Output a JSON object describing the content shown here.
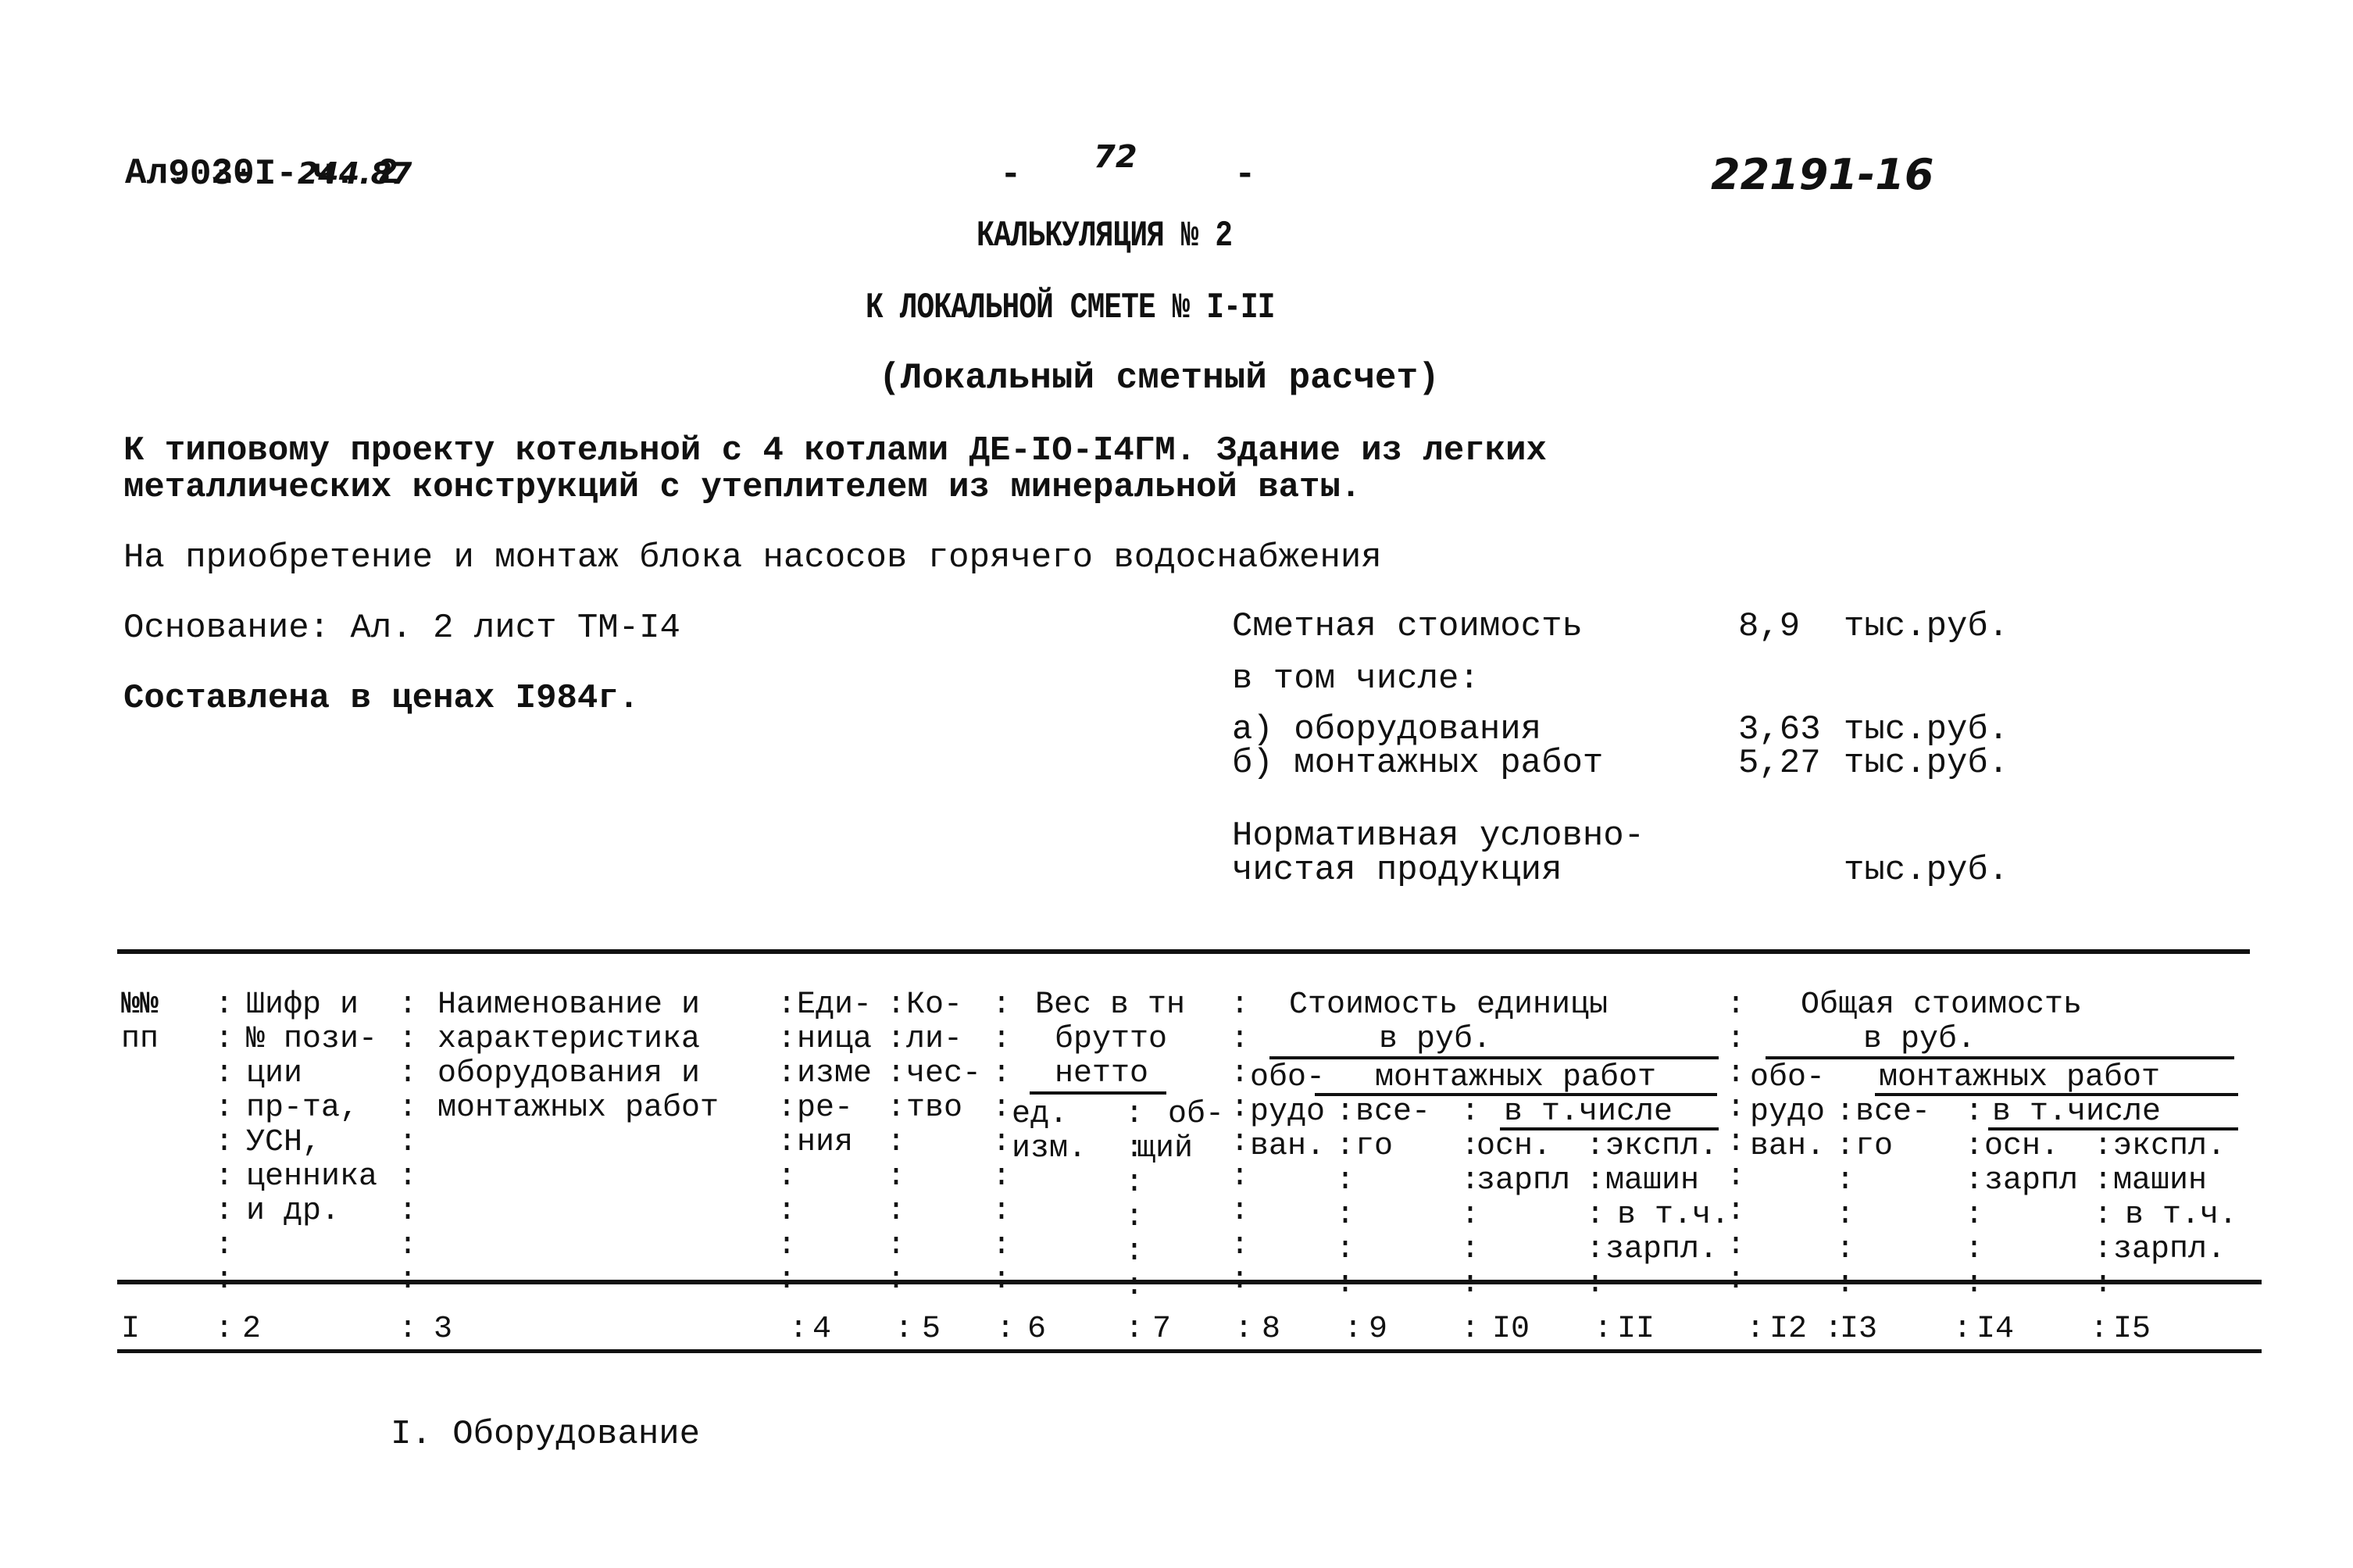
{
  "header": {
    "code": "903-I-",
    "code_handwritten": "244.87",
    "album": "Ал. 20",
    "part": "ч. 2",
    "page_number": "72",
    "page_dash_left": "-",
    "page_dash_right": "-",
    "doc_number": "22191-16"
  },
  "title": {
    "line1": "КАЛЬКУЛЯЦИЯ № 2",
    "line2": "К ЛОКАЛЬНОЙ СМЕТЕ № I-II",
    "line3": "(Локальный сметный расчет)"
  },
  "description": {
    "project_line1": "К типовому проекту котельной с 4 котлами ДЕ-IO-I4ГМ. Здание из легких",
    "project_line2": "металлических конструкций с утеплителем из минеральной ваты.",
    "purpose": "На приобретение и монтаж блока насосов горячего водоснабжения",
    "basis": "Основание: Ал. 2 лист ТМ-I4",
    "prices": "Составлена в ценах I984г."
  },
  "cost_summary": {
    "estimated_cost_label": "Сметная стоимость",
    "estimated_cost_value": "8,9",
    "unit": "тыс.руб.",
    "including_label": "в том числе:",
    "items": [
      {
        "label": "а) оборудования",
        "value": "3,63",
        "unit": "тыс.руб."
      },
      {
        "label": "б) монтажных работ",
        "value": "5,27",
        "unit": "тыс.руб."
      }
    ],
    "normative_label_line1": "Нормативная условно-",
    "normative_label_line2": "чистая продукция",
    "normative_value": "",
    "normative_unit": "тыс.руб."
  },
  "table": {
    "col1": [
      "№№",
      "пп"
    ],
    "col2": [
      "Шифр и",
      "№ пози-",
      "ции",
      "пр-та,",
      "УСН,",
      "ценника",
      "и др."
    ],
    "col3": [
      "Наименование и",
      "характеристика",
      "оборудования и",
      "монтажных работ"
    ],
    "col4": [
      "Еди-",
      "ница",
      "изме",
      "ре-",
      "ния"
    ],
    "col5": [
      "Ко-",
      "ли-",
      "чес-",
      "тво"
    ],
    "weight_group": [
      "Вес в тн",
      "брутто",
      "нетто"
    ],
    "col6": [
      "ед.",
      "изм."
    ],
    "col7": [
      "об-",
      "щий"
    ],
    "unit_cost_group": [
      "Стоимость единицы",
      "в руб."
    ],
    "total_cost_group": [
      "Общая стоимость",
      "в руб."
    ],
    "equipment": [
      "обо-",
      "рудо",
      "ван."
    ],
    "installation_works": "монтажных работ",
    "total": [
      "все-",
      "го"
    ],
    "including": "в т.числе",
    "base_salary": [
      "осн.",
      "зарпл"
    ],
    "machine_operation": [
      "экспл.",
      "машин",
      "в т.ч.",
      "зарпл."
    ],
    "column_numbers": [
      "I",
      "2",
      "3",
      "4",
      "5",
      "6",
      "7",
      "8",
      "9",
      "I0",
      "II",
      "I2",
      "I3",
      "I4",
      "I5"
    ]
  },
  "section": {
    "title": "I. Оборудование"
  }
}
